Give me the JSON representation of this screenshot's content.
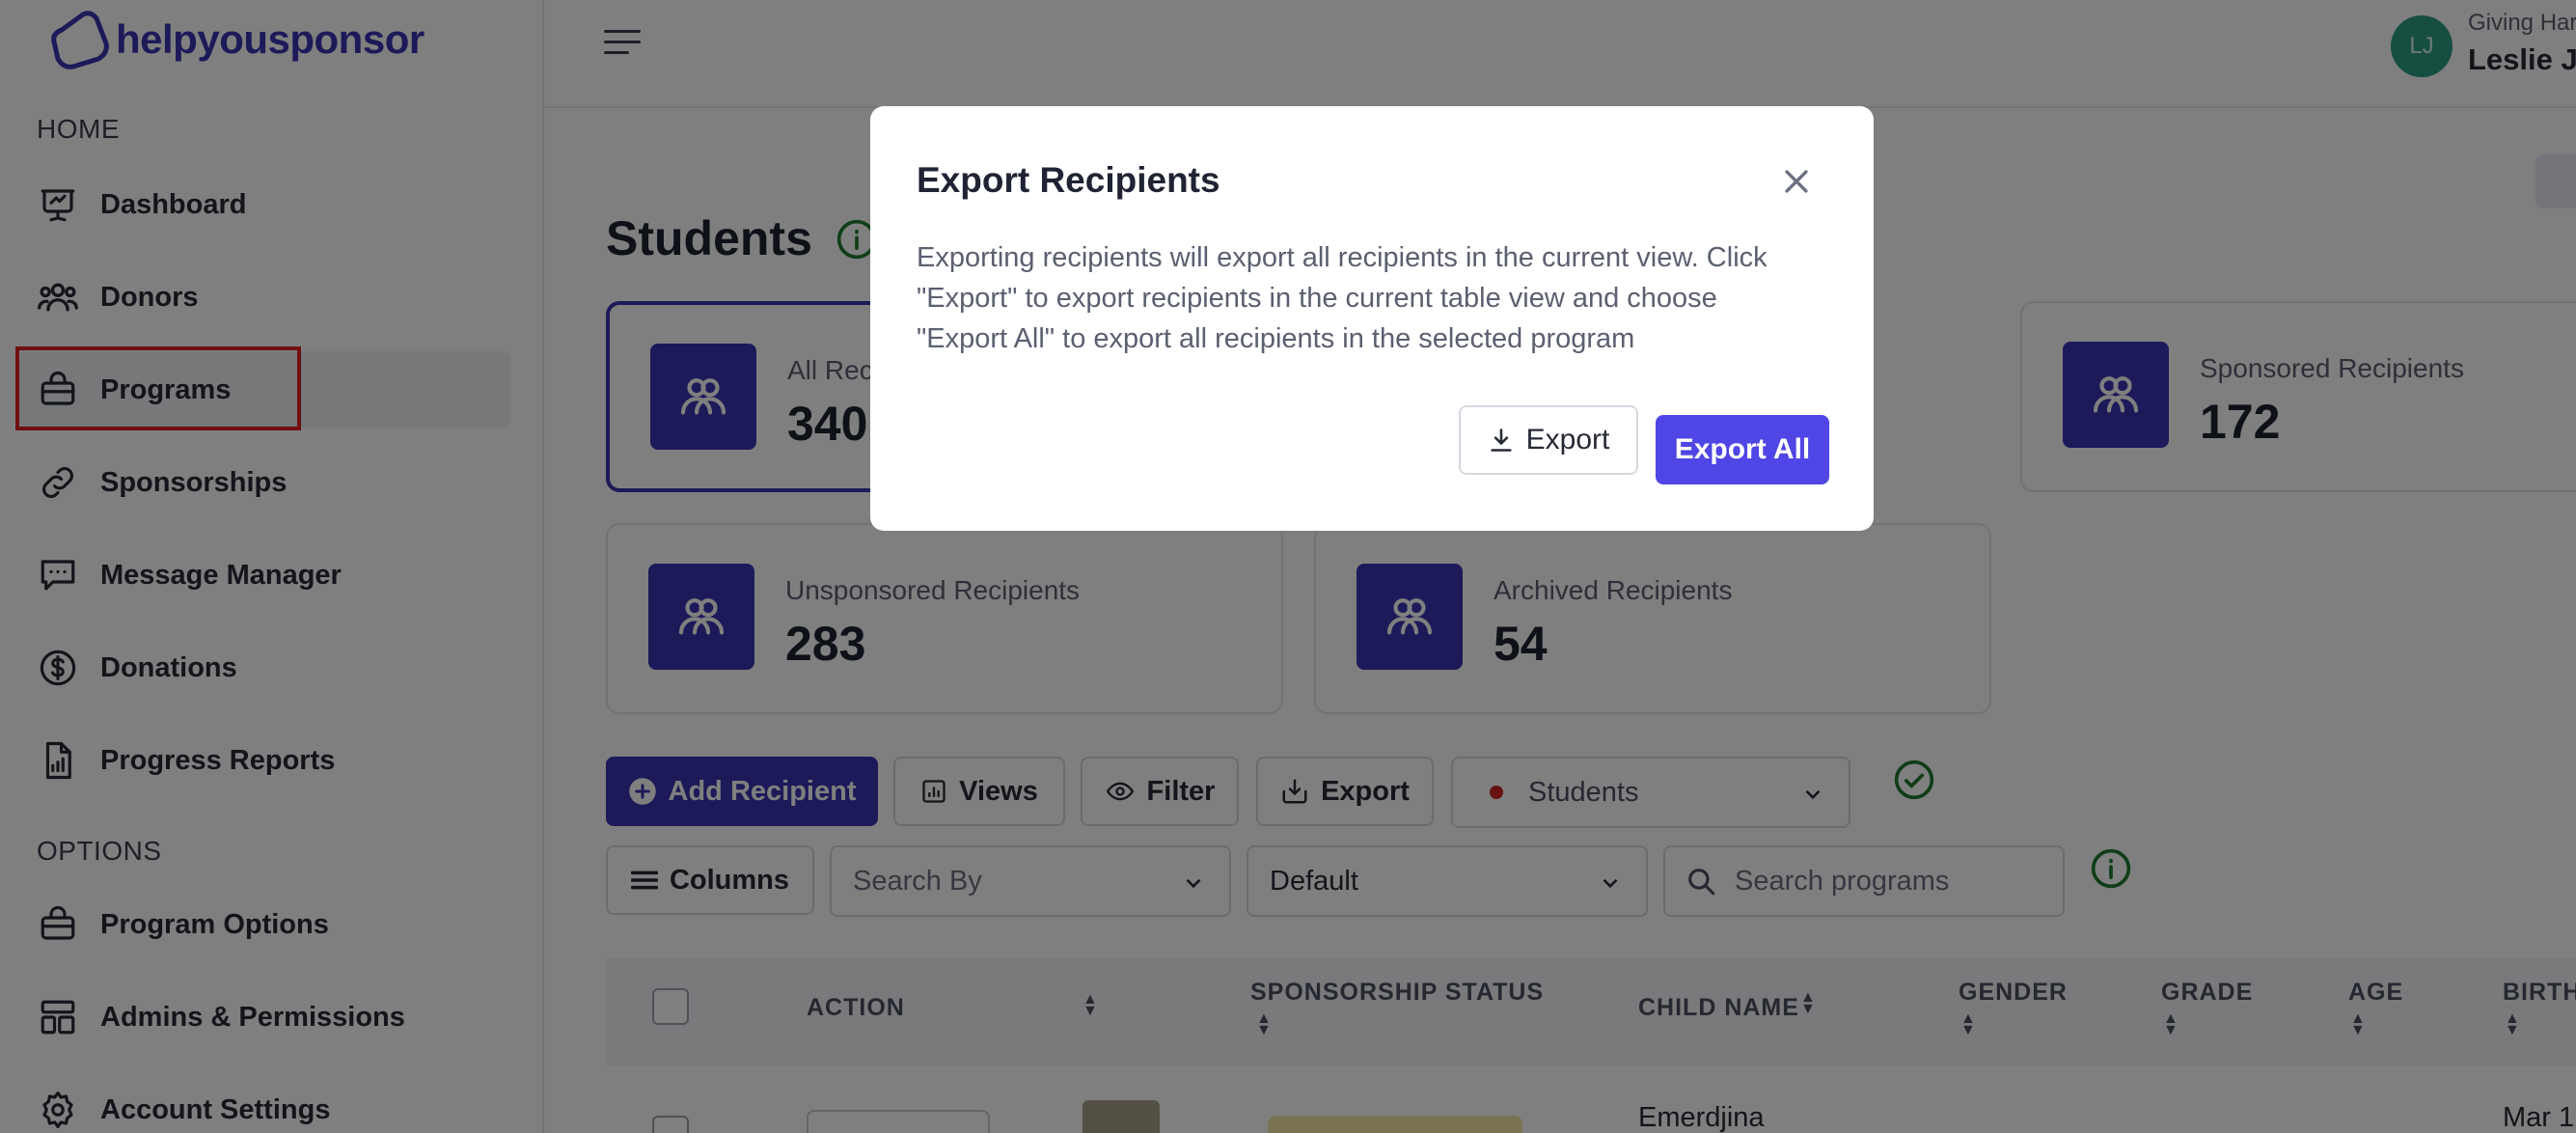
{
  "brand": {
    "name": "helpyousponsor"
  },
  "sidebar": {
    "home_label": "HOME",
    "options_label": "OPTIONS",
    "items": [
      {
        "label": "Dashboard",
        "icon": "presentation-chart-icon"
      },
      {
        "label": "Donors",
        "icon": "users-icon"
      },
      {
        "label": "Programs",
        "icon": "briefcase-icon"
      },
      {
        "label": "Sponsorships",
        "icon": "link-icon"
      },
      {
        "label": "Message Manager",
        "icon": "chat-icon"
      },
      {
        "label": "Donations",
        "icon": "dollar-circle-icon"
      },
      {
        "label": "Progress Reports",
        "icon": "report-icon"
      }
    ],
    "option_items": [
      {
        "label": "Program Options",
        "icon": "briefcase-icon"
      },
      {
        "label": "Admins & Permissions",
        "icon": "layout-icon"
      },
      {
        "label": "Account Settings",
        "icon": "gear-icon"
      }
    ]
  },
  "header": {
    "avatar_initials": "LJ",
    "org_name": "Giving Har",
    "user_name": "Leslie Jo"
  },
  "page": {
    "title": "Students",
    "cards": [
      {
        "label": "All Rec",
        "value": "340"
      },
      {
        "label": "Sponsored Recipients",
        "value": "172"
      },
      {
        "label": "Unsponsored Recipients",
        "value": "283"
      },
      {
        "label": "Archived Recipients",
        "value": "54"
      }
    ]
  },
  "toolbar": {
    "add_recipient": "Add Recipient",
    "views": "Views",
    "filter": "Filter",
    "export": "Export",
    "program_select": "Students",
    "columns": "Columns",
    "search_by_placeholder": "Search By",
    "sort_default": "Default",
    "search_placeholder": "Search programs"
  },
  "table": {
    "headers": [
      "ACTION",
      "SPONSORSHIP STATUS",
      "CHILD NAME",
      "GENDER",
      "GRADE",
      "AGE",
      "BIRTH"
    ],
    "first_row": {
      "name": "Emerdjina",
      "birth": "Mar 1"
    }
  },
  "modal": {
    "title": "Export Recipients",
    "body_lines": [
      "Exporting recipients will export all recipients in the current view. Click",
      "\"Export\" to export recipients in the current table view and choose",
      "\"Export All\" to export all recipients in the selected program"
    ],
    "export_label": "Export",
    "export_all_label": "Export All"
  },
  "colors": {
    "brand": "#3b34b3",
    "primary_button": "#4f46e5",
    "avatar": "#2e9c84",
    "highlight": "#e02020",
    "success": "#1e7a2e"
  }
}
